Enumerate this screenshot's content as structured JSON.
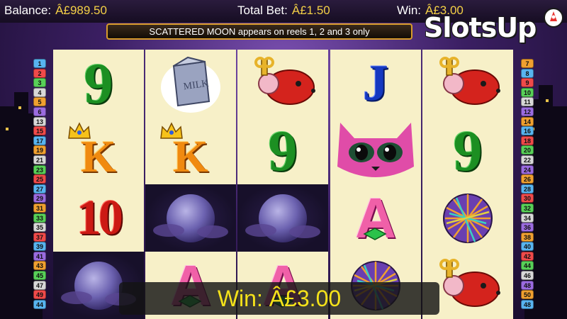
{
  "stats": {
    "balance_label": "Balance:",
    "balance_value": "Â£989.50",
    "bet_label": "Total Bet:",
    "bet_value": "Â£1.50",
    "win_label": "Win:",
    "win_value": "Â£3.00"
  },
  "banner": {
    "message": "SCATTERED MOON appears on reels 1, 2 and 3 only"
  },
  "logo": {
    "text": "SlotsUp"
  },
  "win_display": {
    "text": "Win: Â£3.00"
  },
  "paylines": {
    "left": [
      {
        "n": "1",
        "color": "#58b4f0"
      },
      {
        "n": "2",
        "color": "#f04a4a"
      },
      {
        "n": "3",
        "color": "#58d058"
      },
      {
        "n": "4",
        "color": "#d8d8d8"
      },
      {
        "n": "5",
        "color": "#f0a030"
      },
      {
        "n": "6",
        "color": "#9b6be0"
      },
      {
        "n": "13",
        "color": "#d8d8d8"
      },
      {
        "n": "15",
        "color": "#f04a4a"
      },
      {
        "n": "17",
        "color": "#58b4f0"
      },
      {
        "n": "19",
        "color": "#f0a030"
      },
      {
        "n": "21",
        "color": "#d8d8d8"
      },
      {
        "n": "23",
        "color": "#58d058"
      },
      {
        "n": "25",
        "color": "#f04a4a"
      },
      {
        "n": "27",
        "color": "#58b4f0"
      },
      {
        "n": "29",
        "color": "#9b6be0"
      },
      {
        "n": "31",
        "color": "#f0a030"
      },
      {
        "n": "33",
        "color": "#58d058"
      },
      {
        "n": "35",
        "color": "#d8d8d8"
      },
      {
        "n": "37",
        "color": "#f04a4a"
      },
      {
        "n": "39",
        "color": "#58b4f0"
      },
      {
        "n": "41",
        "color": "#9b6be0"
      },
      {
        "n": "43",
        "color": "#f0a030"
      },
      {
        "n": "45",
        "color": "#58d058"
      },
      {
        "n": "47",
        "color": "#d8d8d8"
      },
      {
        "n": "49",
        "color": "#f04a4a"
      },
      {
        "n": "44",
        "color": "#58b4f0"
      }
    ],
    "right": [
      {
        "n": "7",
        "color": "#f0a030"
      },
      {
        "n": "8",
        "color": "#58b4f0"
      },
      {
        "n": "9",
        "color": "#f04a4a"
      },
      {
        "n": "10",
        "color": "#58d058"
      },
      {
        "n": "11",
        "color": "#d8d8d8"
      },
      {
        "n": "12",
        "color": "#9b6be0"
      },
      {
        "n": "14",
        "color": "#f0a030"
      },
      {
        "n": "16",
        "color": "#58b4f0"
      },
      {
        "n": "18",
        "color": "#f04a4a"
      },
      {
        "n": "20",
        "color": "#58d058"
      },
      {
        "n": "22",
        "color": "#d8d8d8"
      },
      {
        "n": "24",
        "color": "#9b6be0"
      },
      {
        "n": "26",
        "color": "#f0a030"
      },
      {
        "n": "28",
        "color": "#58b4f0"
      },
      {
        "n": "30",
        "color": "#f04a4a"
      },
      {
        "n": "32",
        "color": "#58d058"
      },
      {
        "n": "34",
        "color": "#d8d8d8"
      },
      {
        "n": "36",
        "color": "#9b6be0"
      },
      {
        "n": "38",
        "color": "#f0a030"
      },
      {
        "n": "40",
        "color": "#58b4f0"
      },
      {
        "n": "42",
        "color": "#f04a4a"
      },
      {
        "n": "44",
        "color": "#58d058"
      },
      {
        "n": "46",
        "color": "#d8d8d8"
      },
      {
        "n": "48",
        "color": "#9b6be0"
      },
      {
        "n": "50",
        "color": "#f0a030"
      },
      {
        "n": "48",
        "color": "#58b4f0"
      }
    ]
  },
  "reels": [
    {
      "symbols": [
        {
          "type": "9",
          "text": "9"
        },
        {
          "type": "K",
          "text": "K"
        },
        {
          "type": "10",
          "text": "10"
        },
        {
          "type": "moon",
          "text": ""
        }
      ]
    },
    {
      "symbols": [
        {
          "type": "milk",
          "text": "MILK"
        },
        {
          "type": "K",
          "text": "K"
        },
        {
          "type": "moon",
          "text": ""
        },
        {
          "type": "A",
          "text": "A"
        }
      ]
    },
    {
      "symbols": [
        {
          "type": "mouse",
          "text": ""
        },
        {
          "type": "9",
          "text": "9"
        },
        {
          "type": "moon",
          "text": ""
        },
        {
          "type": "A",
          "text": "A"
        }
      ]
    },
    {
      "symbols": [
        {
          "type": "J",
          "text": "J"
        },
        {
          "type": "cat",
          "text": ""
        },
        {
          "type": "A",
          "text": "A"
        },
        {
          "type": "yarn",
          "text": ""
        }
      ]
    },
    {
      "symbols": [
        {
          "type": "mouse",
          "text": ""
        },
        {
          "type": "9",
          "text": "9"
        },
        {
          "type": "yarn",
          "text": ""
        },
        {
          "type": "mouse",
          "text": ""
        }
      ]
    }
  ]
}
